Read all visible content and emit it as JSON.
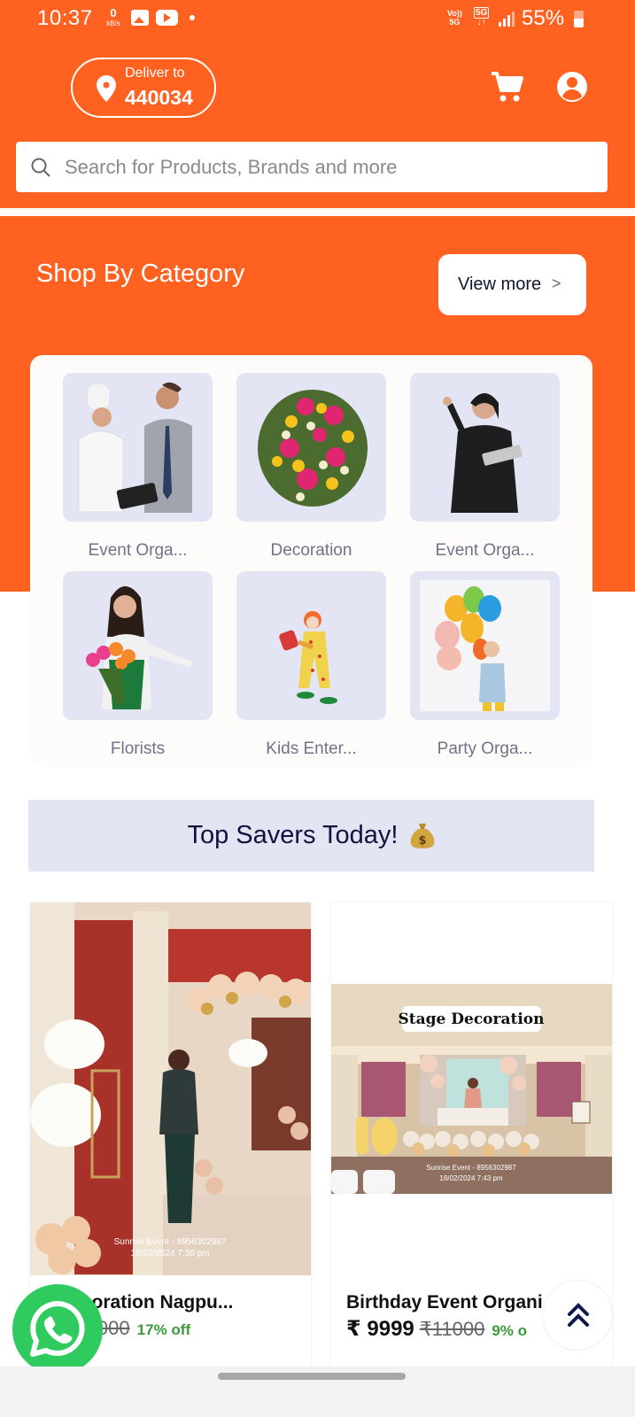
{
  "status_bar": {
    "time": "10:37",
    "net_speed_value": "0",
    "net_speed_unit": "kB/s",
    "volte_label": "Vo))",
    "volte_sub": "5G",
    "network_type": "5G",
    "battery_percent": "55%"
  },
  "header": {
    "deliver_label": "Deliver to",
    "pincode": "440034",
    "search_placeholder": "Search for Products, Brands and more"
  },
  "categories": {
    "title": "Shop By Category",
    "view_more_label": "View more",
    "items": [
      {
        "label": "Event Orga...",
        "image": "chef-and-manager"
      },
      {
        "label": "Decoration",
        "image": "flower-bouquet"
      },
      {
        "label": "Event Orga...",
        "image": "businesswoman-with-tablet"
      },
      {
        "label": "Florists",
        "image": "florist-with-flowers"
      },
      {
        "label": "Kids Enter...",
        "image": "clown"
      },
      {
        "label": "Party Orga...",
        "image": "girl-with-balloons"
      }
    ]
  },
  "top_savers": {
    "title": "Top Savers Today!",
    "emoji_icon": "money-bag"
  },
  "products": [
    {
      "name": "r Decoration Nagpu...",
      "price": "99",
      "mrp": "₹6000",
      "discount": "17% off",
      "image_caption": "Sunrise Event - 8956302987",
      "image_date": "18/02/2024 7:30 pm"
    },
    {
      "name": "Birthday Event Organi",
      "price": "₹ 9999",
      "mrp": "₹11000",
      "discount": "9% o",
      "image_banner": "Stage Decoration",
      "image_caption": "Sunrise Event - 8956302987",
      "image_date": "18/02/2024 7:43 pm"
    }
  ],
  "colors": {
    "brand_orange": "#ff6220",
    "category_tile": "#e4e5f4",
    "discount_green": "#3a9a3a",
    "whatsapp_green": "#2fcb5f",
    "navy": "#0f1340"
  }
}
